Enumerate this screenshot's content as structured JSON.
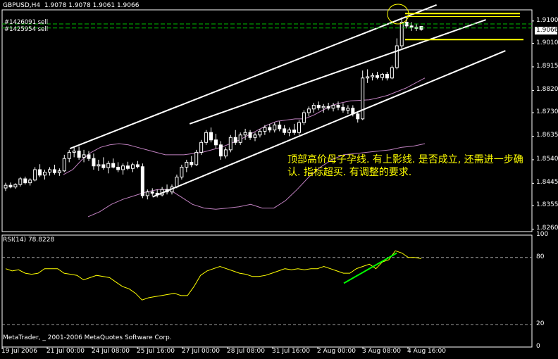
{
  "chart_title": "GBPUSD,H4  1.9078 1.9078 1.9061 1.9066",
  "orders": [
    "#1426091 sell",
    "#1425954 sell"
  ],
  "current_price": "1.9066",
  "annotation": "顶部高价母子孕线. 有上影线. 是否成立, 还需进一步确认. 指标超买. 有调整的要求.",
  "rsi_title": "RSI(14) 78.8228",
  "footer": "MetaTrader, _ 2001-2006 MetaQuotes Software Corp.",
  "colors": {
    "background": "#000000",
    "candle": "#ffffff",
    "bollinger": "#c080c0",
    "trendline": "#ffffff",
    "horizontal_lines": "#ffff00",
    "order_lines": "#00c000",
    "rsi_line": "#ffff00",
    "rsi_trendline": "#00ff00",
    "annotation": "#ffff00"
  },
  "chart_data": [
    {
      "type": "candlestick",
      "symbol": "GBPUSD",
      "timeframe": "H4",
      "ohlc_last": {
        "open": 1.9078,
        "high": 1.9078,
        "low": 1.9061,
        "close": 1.9066
      },
      "y_tick_labels": [
        "1.9100",
        "1.9010",
        "1.8915",
        "1.8820",
        "1.8730",
        "1.8635",
        "1.8540",
        "1.8445",
        "1.8355",
        "1.8260"
      ],
      "y_ticks": [
        1.91,
        1.901,
        1.8915,
        1.882,
        1.873,
        1.8635,
        1.854,
        1.8445,
        1.8355,
        1.826
      ],
      "ylim": [
        1.825,
        1.9145
      ],
      "x_tick_labels": [
        "19 Jul 2006",
        "21 Jul 00:00",
        "24 Jul 08:00",
        "25 Jul 16:00",
        "27 Jul 00:00",
        "28 Jul 08:00",
        "31 Jul 16:00",
        "2 Aug 00:00",
        "3 Aug 08:00",
        "4 Aug 16:00"
      ],
      "candles": [
        [
          1.8426,
          1.8447,
          1.8414,
          1.8437
        ],
        [
          1.8437,
          1.8448,
          1.8425,
          1.843
        ],
        [
          1.843,
          1.8445,
          1.8423,
          1.844
        ],
        [
          1.844,
          1.847,
          1.8432,
          1.8463
        ],
        [
          1.8463,
          1.8472,
          1.844,
          1.8447
        ],
        [
          1.8447,
          1.8465,
          1.8436,
          1.8458
        ],
        [
          1.8458,
          1.851,
          1.8453,
          1.85
        ],
        [
          1.85,
          1.8522,
          1.847,
          1.8478
        ],
        [
          1.8478,
          1.85,
          1.846,
          1.849
        ],
        [
          1.849,
          1.851,
          1.8476,
          1.85
        ],
        [
          1.85,
          1.852,
          1.848,
          1.8488
        ],
        [
          1.8488,
          1.8505,
          1.8475,
          1.8495
        ],
        [
          1.8495,
          1.856,
          1.849,
          1.8545
        ],
        [
          1.8545,
          1.858,
          1.853,
          1.857
        ],
        [
          1.857,
          1.859,
          1.855,
          1.8575
        ],
        [
          1.8575,
          1.8593,
          1.854,
          1.855
        ],
        [
          1.855,
          1.858,
          1.853,
          1.856
        ],
        [
          1.856,
          1.8575,
          1.8535,
          1.8545
        ],
        [
          1.8545,
          1.8565,
          1.85,
          1.8515
        ],
        [
          1.8515,
          1.854,
          1.8495,
          1.852
        ],
        [
          1.852,
          1.855,
          1.85,
          1.8508
        ],
        [
          1.8508,
          1.8535,
          1.8485,
          1.8525
        ],
        [
          1.8525,
          1.8545,
          1.8505,
          1.851
        ],
        [
          1.851,
          1.853,
          1.849,
          1.85
        ],
        [
          1.85,
          1.8525,
          1.848,
          1.8515
        ],
        [
          1.8515,
          1.8532,
          1.8498,
          1.8505
        ],
        [
          1.8505,
          1.8528,
          1.849,
          1.852
        ],
        [
          1.852,
          1.8535,
          1.8505,
          1.8512
        ],
        [
          1.8512,
          1.8525,
          1.8385,
          1.8395
        ],
        [
          1.8395,
          1.842,
          1.838,
          1.841
        ],
        [
          1.841,
          1.8425,
          1.8395,
          1.8405
        ],
        [
          1.8405,
          1.842,
          1.8388,
          1.8398
        ],
        [
          1.8398,
          1.843,
          1.8392,
          1.842
        ],
        [
          1.842,
          1.844,
          1.84,
          1.841
        ],
        [
          1.841,
          1.844,
          1.84,
          1.843
        ],
        [
          1.843,
          1.848,
          1.8425,
          1.847
        ],
        [
          1.847,
          1.852,
          1.846,
          1.851
        ],
        [
          1.851,
          1.854,
          1.849,
          1.853
        ],
        [
          1.853,
          1.8555,
          1.851,
          1.852
        ],
        [
          1.852,
          1.858,
          1.8515,
          1.857
        ],
        [
          1.857,
          1.862,
          1.856,
          1.861
        ],
        [
          1.861,
          1.866,
          1.86,
          1.865
        ],
        [
          1.865,
          1.867,
          1.861,
          1.862
        ],
        [
          1.862,
          1.8645,
          1.8585,
          1.86
        ],
        [
          1.86,
          1.8615,
          1.854,
          1.8555
        ],
        [
          1.8555,
          1.859,
          1.8545,
          1.858
        ],
        [
          1.858,
          1.864,
          1.857,
          1.863
        ],
        [
          1.863,
          1.866,
          1.86,
          1.861
        ],
        [
          1.861,
          1.865,
          1.86,
          1.864
        ],
        [
          1.864,
          1.8665,
          1.862,
          1.865
        ],
        [
          1.865,
          1.866,
          1.862,
          1.863
        ],
        [
          1.863,
          1.865,
          1.8615,
          1.864
        ],
        [
          1.864,
          1.8665,
          1.863,
          1.8655
        ],
        [
          1.8655,
          1.868,
          1.864,
          1.867
        ],
        [
          1.867,
          1.8685,
          1.865,
          1.866
        ],
        [
          1.866,
          1.869,
          1.865,
          1.868
        ],
        [
          1.868,
          1.8695,
          1.8655,
          1.8665
        ],
        [
          1.8665,
          1.868,
          1.864,
          1.865
        ],
        [
          1.865,
          1.867,
          1.8635,
          1.866
        ],
        [
          1.866,
          1.8685,
          1.864,
          1.865
        ],
        [
          1.865,
          1.87,
          1.864,
          1.869
        ],
        [
          1.869,
          1.874,
          1.868,
          1.873
        ],
        [
          1.873,
          1.8755,
          1.8715,
          1.8745
        ],
        [
          1.8745,
          1.877,
          1.873,
          1.876
        ],
        [
          1.876,
          1.8775,
          1.874,
          1.875
        ],
        [
          1.875,
          1.8765,
          1.873,
          1.8755
        ],
        [
          1.8755,
          1.877,
          1.874,
          1.8748
        ],
        [
          1.8748,
          1.877,
          1.8735,
          1.876
        ],
        [
          1.876,
          1.8775,
          1.874,
          1.8752
        ],
        [
          1.8752,
          1.8768,
          1.873,
          1.874
        ],
        [
          1.874,
          1.876,
          1.8725,
          1.8748
        ],
        [
          1.8748,
          1.876,
          1.8715,
          1.8725
        ],
        [
          1.8725,
          1.8735,
          1.869,
          1.8705
        ],
        [
          1.8705,
          1.89,
          1.87,
          1.887
        ],
        [
          1.887,
          1.8905,
          1.885,
          1.8875
        ],
        [
          1.8875,
          1.889,
          1.886,
          1.888
        ],
        [
          1.888,
          1.8895,
          1.8865,
          1.8872
        ],
        [
          1.8872,
          1.889,
          1.886,
          1.8885
        ],
        [
          1.8885,
          1.8895,
          1.886,
          1.887
        ],
        [
          1.887,
          1.892,
          1.8865,
          1.8912
        ],
        [
          1.8912,
          1.903,
          1.8905,
          1.9
        ],
        [
          1.9,
          1.9115,
          1.899,
          1.9095
        ],
        [
          1.9095,
          1.912,
          1.907,
          1.908
        ],
        [
          1.908,
          1.9095,
          1.906,
          1.9075
        ],
        [
          1.9075,
          1.909,
          1.906,
          1.907
        ],
        [
          1.9078,
          1.9078,
          1.9061,
          1.9066
        ]
      ],
      "bollinger_upper": [
        1.848,
        1.85,
        1.854,
        1.857,
        1.859,
        1.86,
        1.8605,
        1.86,
        1.859,
        1.858,
        1.857,
        1.856,
        1.856,
        1.856,
        1.8565,
        1.857,
        1.858,
        1.859,
        1.8605,
        1.862,
        1.864,
        1.866,
        1.868,
        1.8695,
        1.87,
        1.8705,
        1.8705,
        1.872,
        1.874,
        1.876,
        1.877,
        1.8778,
        1.878,
        1.8782,
        1.879,
        1.88,
        1.8815,
        1.883,
        1.885,
        1.887
      ],
      "bollinger_lower": [
        1.831,
        1.833,
        1.836,
        1.838,
        1.8395,
        1.841,
        1.842,
        1.842,
        1.839,
        1.836,
        1.8345,
        1.834,
        1.8345,
        1.835,
        1.836,
        1.8345,
        1.8345,
        1.8375,
        1.842,
        1.847,
        1.851,
        1.854,
        1.856,
        1.8565,
        1.857,
        1.8575,
        1.858,
        1.859,
        1.8595,
        1.8605
      ],
      "trendlines": [
        {
          "from": [
            1.8585,
            0.128
          ],
          "to": [
            1.9165,
            0.82
          ]
        },
        {
          "from": [
            1.8685,
            0.354
          ],
          "to": [
            1.9105,
            0.913
          ]
        },
        {
          "from": [
            1.839,
            0.284
          ],
          "to": [
            1.898,
            0.95
          ]
        }
      ],
      "horizontal_levels": [
        1.913,
        1.9118,
        1.9025
      ],
      "order_levels": [
        1.9088,
        1.9072
      ]
    },
    {
      "type": "line",
      "title": "RSI(14) 78.8228",
      "y_tick_labels": [
        "100",
        "80",
        "20",
        "0"
      ],
      "y_ticks": [
        100,
        80,
        20,
        0
      ],
      "ylim": [
        0,
        100
      ],
      "levels": [
        80,
        20
      ],
      "series": [
        {
          "values": [
            70,
            68,
            69,
            66,
            65,
            66,
            70,
            70,
            70,
            66,
            65,
            64,
            60,
            62,
            64,
            63,
            62,
            58,
            54,
            52,
            48,
            42,
            44,
            45,
            46,
            47,
            48,
            46,
            46,
            54,
            64,
            68,
            70,
            72,
            70,
            68,
            66,
            65,
            63,
            63,
            64,
            66,
            68,
            70,
            69,
            70,
            69,
            70,
            70,
            72,
            70,
            68,
            66,
            66,
            70,
            72,
            74,
            70,
            76,
            78,
            86,
            84,
            80,
            80,
            79
          ]
        }
      ],
      "trendline": {
        "from": [
          57,
          0.645
        ],
        "to": [
          84,
          0.745
        ]
      }
    }
  ]
}
